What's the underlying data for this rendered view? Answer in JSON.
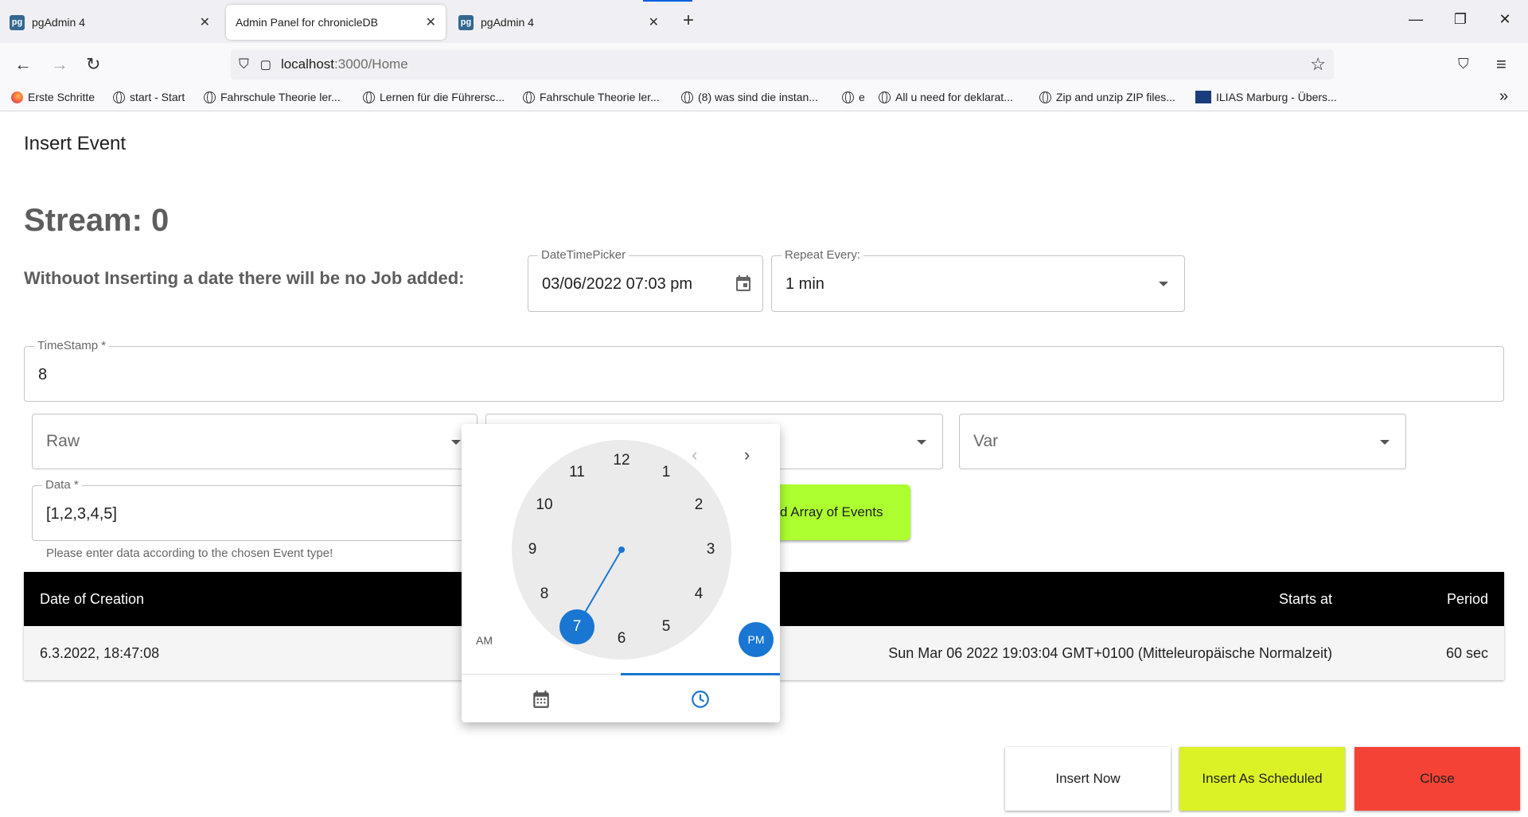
{
  "browser": {
    "tabs": [
      {
        "label": "pgAdmin 4",
        "icon": "pg"
      },
      {
        "label": "Admin Panel for chronicleDB",
        "icon": ""
      },
      {
        "label": "pgAdmin 4",
        "icon": "pg"
      }
    ],
    "url_host": "localhost",
    "url_path": ":3000/Home",
    "bookmarks": [
      "Erste Schritte",
      "start - Start",
      "Fahrschule Theorie ler...",
      "Lernen für die Führersc...",
      "Fahrschule Theorie ler...",
      "(8) was sind die instan...",
      "e",
      "All u need for deklarat...",
      "Zip and unzip ZIP files...",
      "ILIAS Marburg - Übers..."
    ]
  },
  "dialog": {
    "title": "Insert Event",
    "stream": "Stream: 0",
    "note": "Withouot Inserting a date there will be no Job added:",
    "datetime": {
      "legend": "DateTimePicker",
      "value": "03/06/2022 07:03 pm"
    },
    "repeat": {
      "legend": "Repeat Every:",
      "value": "1 min"
    },
    "timestamp": {
      "legend": "TimeStamp *",
      "value": "8"
    },
    "event_type": {
      "value": "Raw"
    },
    "var_select": {
      "value": "Var"
    },
    "data": {
      "legend": "Data *",
      "value": "[1,2,3,4,5]",
      "helper": "Please enter data according to the chosen Event type!"
    },
    "array_button": "d Array of Events",
    "table": {
      "headers": {
        "created": "Date of Creation",
        "starts": "Starts at",
        "period": "Period"
      },
      "rows": [
        {
          "created": "6.3.2022, 18:47:08",
          "starts": "Sun Mar 06 2022 19:03:04 GMT+0100 (Mitteleuropäische Normalzeit)",
          "period": "60 sec"
        }
      ]
    },
    "buttons": {
      "insert_now": "Insert Now",
      "insert_scheduled": "Insert As Scheduled",
      "close": "Close"
    }
  },
  "picker": {
    "hours": [
      "12",
      "1",
      "2",
      "3",
      "4",
      "5",
      "6",
      "7",
      "8",
      "9",
      "10",
      "11"
    ],
    "selected_hour": "7",
    "am": "AM",
    "pm": "PM",
    "active_tab": "clock"
  },
  "colors": {
    "accent": "#1976d2",
    "lime": "#adff2f",
    "yellow": "#dbf226",
    "red": "#f44336"
  }
}
